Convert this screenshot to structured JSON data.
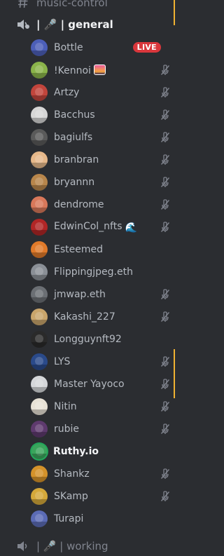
{
  "channels": {
    "top": {
      "name": "music-control",
      "icon": "hashtag-threads-icon"
    },
    "current": {
      "name": "| 🎤 | general",
      "icon": "voice-speaker-icon"
    },
    "bottom": {
      "name": "| 🎤 | working",
      "icon": "voice-speaker-icon"
    }
  },
  "live_label": "LIVE",
  "members": [
    {
      "name": "Bottle",
      "live": true,
      "muted": false,
      "color": "#4c5fb8"
    },
    {
      "name": "!Kennoi",
      "emoji": "sunset",
      "muted": true,
      "color": "#8ab34a"
    },
    {
      "name": "Artzy",
      "muted": true,
      "color": "#c2453c"
    },
    {
      "name": "Bacchus",
      "muted": true,
      "color": "#d6d6d6"
    },
    {
      "name": "bagiulfs",
      "muted": true,
      "color": "#5a5a5a"
    },
    {
      "name": "branbran",
      "muted": true,
      "color": "#e6b88a"
    },
    {
      "name": "bryannn",
      "muted": true,
      "color": "#b8864b"
    },
    {
      "name": "dendrome",
      "muted": true,
      "color": "#d9785a"
    },
    {
      "name": "EdwinCol_nfts",
      "emoji": "wave",
      "emoji_char": "🌊",
      "muted": true,
      "color": "#b02626"
    },
    {
      "name": "Esteemed",
      "muted": false,
      "color": "#e07a2a"
    },
    {
      "name": "Flippingjpeg.eth",
      "muted": false,
      "color": "#8a8f96"
    },
    {
      "name": "jmwap.eth",
      "muted": true,
      "color": "#6b6f74"
    },
    {
      "name": "Kakashi_227",
      "muted": true,
      "color": "#c9a56b"
    },
    {
      "name": "Longguynft92",
      "muted": false,
      "color": "#2a2a2a"
    },
    {
      "name": "LYS",
      "muted": true,
      "color": "#2a4a8a"
    },
    {
      "name": "Master Yayoco",
      "muted": true,
      "color": "#d5d7da"
    },
    {
      "name": "Nitin",
      "muted": true,
      "color": "#e8e2d6"
    },
    {
      "name": "rubie",
      "muted": true,
      "color": "#5e3a6e"
    },
    {
      "name": "Ruthy.io",
      "bright": true,
      "speaking": true,
      "muted": false,
      "color": "#3ba55c"
    },
    {
      "name": "Shankz",
      "muted": true,
      "color": "#d4922a"
    },
    {
      "name": "SKamp",
      "muted": true,
      "color": "#d4a83a"
    },
    {
      "name": "Turapi",
      "muted": false,
      "color": "#5b6bb5"
    }
  ]
}
